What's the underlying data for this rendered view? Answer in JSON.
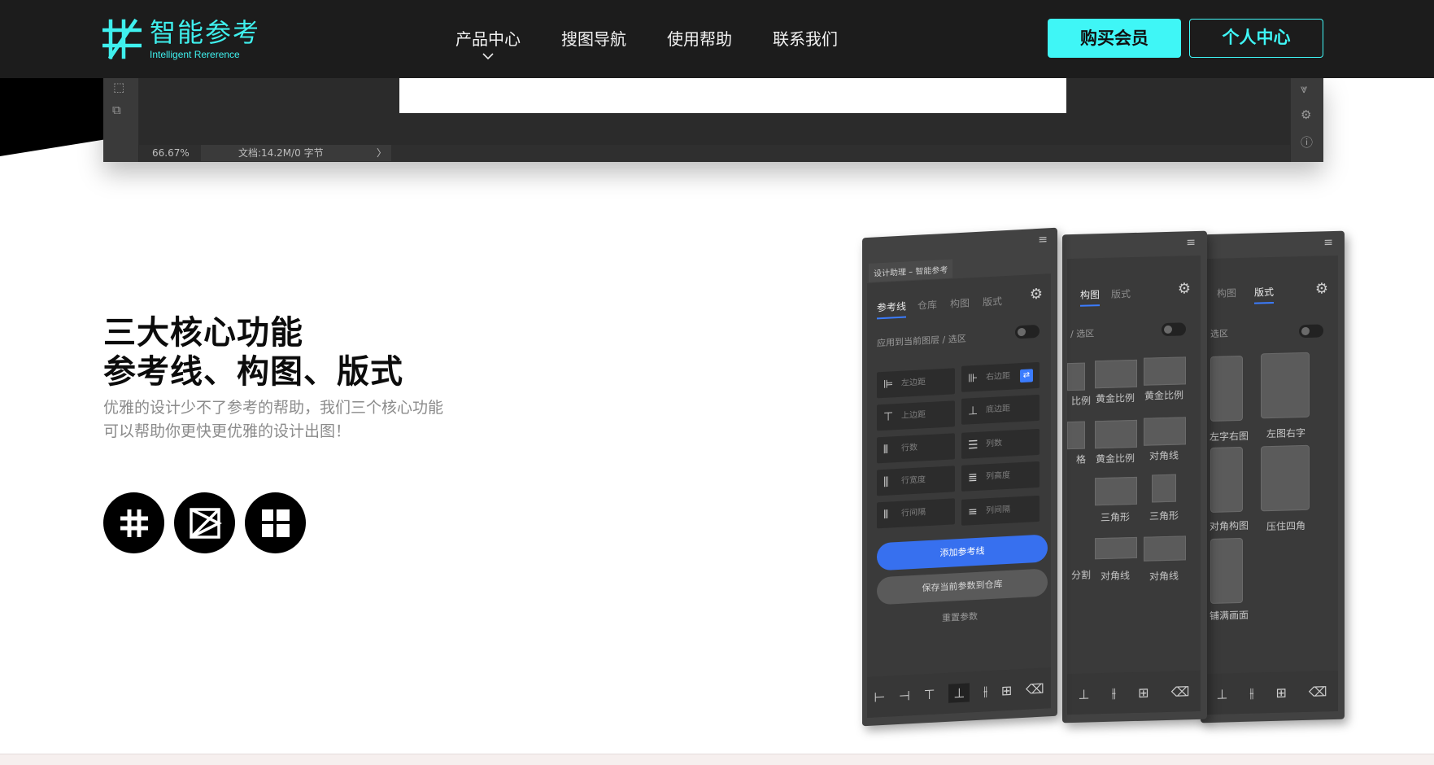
{
  "brand": {
    "name_cn": "智能参考",
    "name_en": "Intelligent Rererence",
    "accent": "#3ff6f6"
  },
  "nav": {
    "items": [
      {
        "label": "产品中心",
        "has_dropdown": true
      },
      {
        "label": "搜图导航"
      },
      {
        "label": "使用帮助"
      },
      {
        "label": "联系我们"
      }
    ],
    "buy_label": "购买会员",
    "user_label": "个人中心"
  },
  "app_status": {
    "zoom": "66.67%",
    "doc_info": "文档:14.2M/0 字节",
    "arrow": "〉"
  },
  "feature": {
    "title_line1": "三大核心功能",
    "title_line2": "参考线、构图、版式",
    "desc_line1": "优雅的设计少不了参考的帮助，我们三个核心功能",
    "desc_line2": "可以帮助你更快更优雅的设计出图！",
    "icons": [
      "grid-hash-icon",
      "composition-icon",
      "layout-icon"
    ]
  },
  "panel_main": {
    "title": "设计助理 – 智能参考",
    "tabs": [
      "参考线",
      "仓库",
      "构图",
      "版式"
    ],
    "apply_label": "应用到当前图层 / 选区",
    "cells": [
      {
        "icon": "⊫",
        "label": "左边距"
      },
      {
        "icon": "⊪",
        "label": "右边距"
      },
      {
        "icon": "⊤",
        "label": "上边距"
      },
      {
        "icon": "⊥",
        "label": "底边距"
      },
      {
        "icon": "⫴",
        "label": "行数"
      },
      {
        "icon": "☰",
        "label": "列数"
      },
      {
        "icon": "⫼",
        "label": "行宽度"
      },
      {
        "icon": "≣",
        "label": "列高度"
      },
      {
        "icon": "⦀",
        "label": "行间隔"
      },
      {
        "icon": "≡",
        "label": "列间隔"
      }
    ],
    "add_label": "添加参考线",
    "save_label": "保存当前参数到仓库",
    "reset_label": "重置参数"
  },
  "panel_mid": {
    "tabs": [
      "构图",
      "版式"
    ],
    "apply_partial": "/ 选区",
    "labels": [
      "比例",
      "黄金比例",
      "黄金比例",
      "格",
      "黄金比例",
      "对角线",
      "三角形",
      "三角形",
      "分割",
      "对角线",
      "对角线"
    ]
  },
  "panel_right": {
    "tabs": [
      "构图",
      "版式"
    ],
    "apply_partial": "选区",
    "labels": [
      "左字右图",
      "左图右字",
      "对角构图",
      "压住四角",
      "铺满画面"
    ]
  }
}
